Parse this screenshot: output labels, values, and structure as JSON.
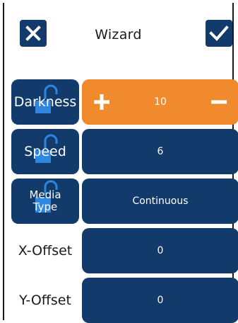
{
  "header": {
    "title": "Wizard",
    "close_icon": "close-icon",
    "confirm_icon": "checkmark-icon"
  },
  "rows": [
    {
      "label": "Darkness",
      "value": "10",
      "locked_icon": "unlock-icon",
      "active": true
    },
    {
      "label": "Speed",
      "value": "6",
      "locked_icon": "unlock-icon"
    },
    {
      "label": "Media Type",
      "label_lines": [
        "Media",
        "Type"
      ],
      "value": "Continuous",
      "locked_icon": "unlock-icon"
    },
    {
      "label": "X-Offset",
      "value": "0"
    },
    {
      "label": "Y-Offset",
      "value": "0"
    }
  ],
  "stepper": {
    "increment_icon": "plus-icon",
    "decrement_icon": "minus-icon"
  },
  "colors": {
    "navy": "#123a6b",
    "accent": "#f08a2c",
    "lock": "#2e86de",
    "text": "#1a1a1a"
  }
}
